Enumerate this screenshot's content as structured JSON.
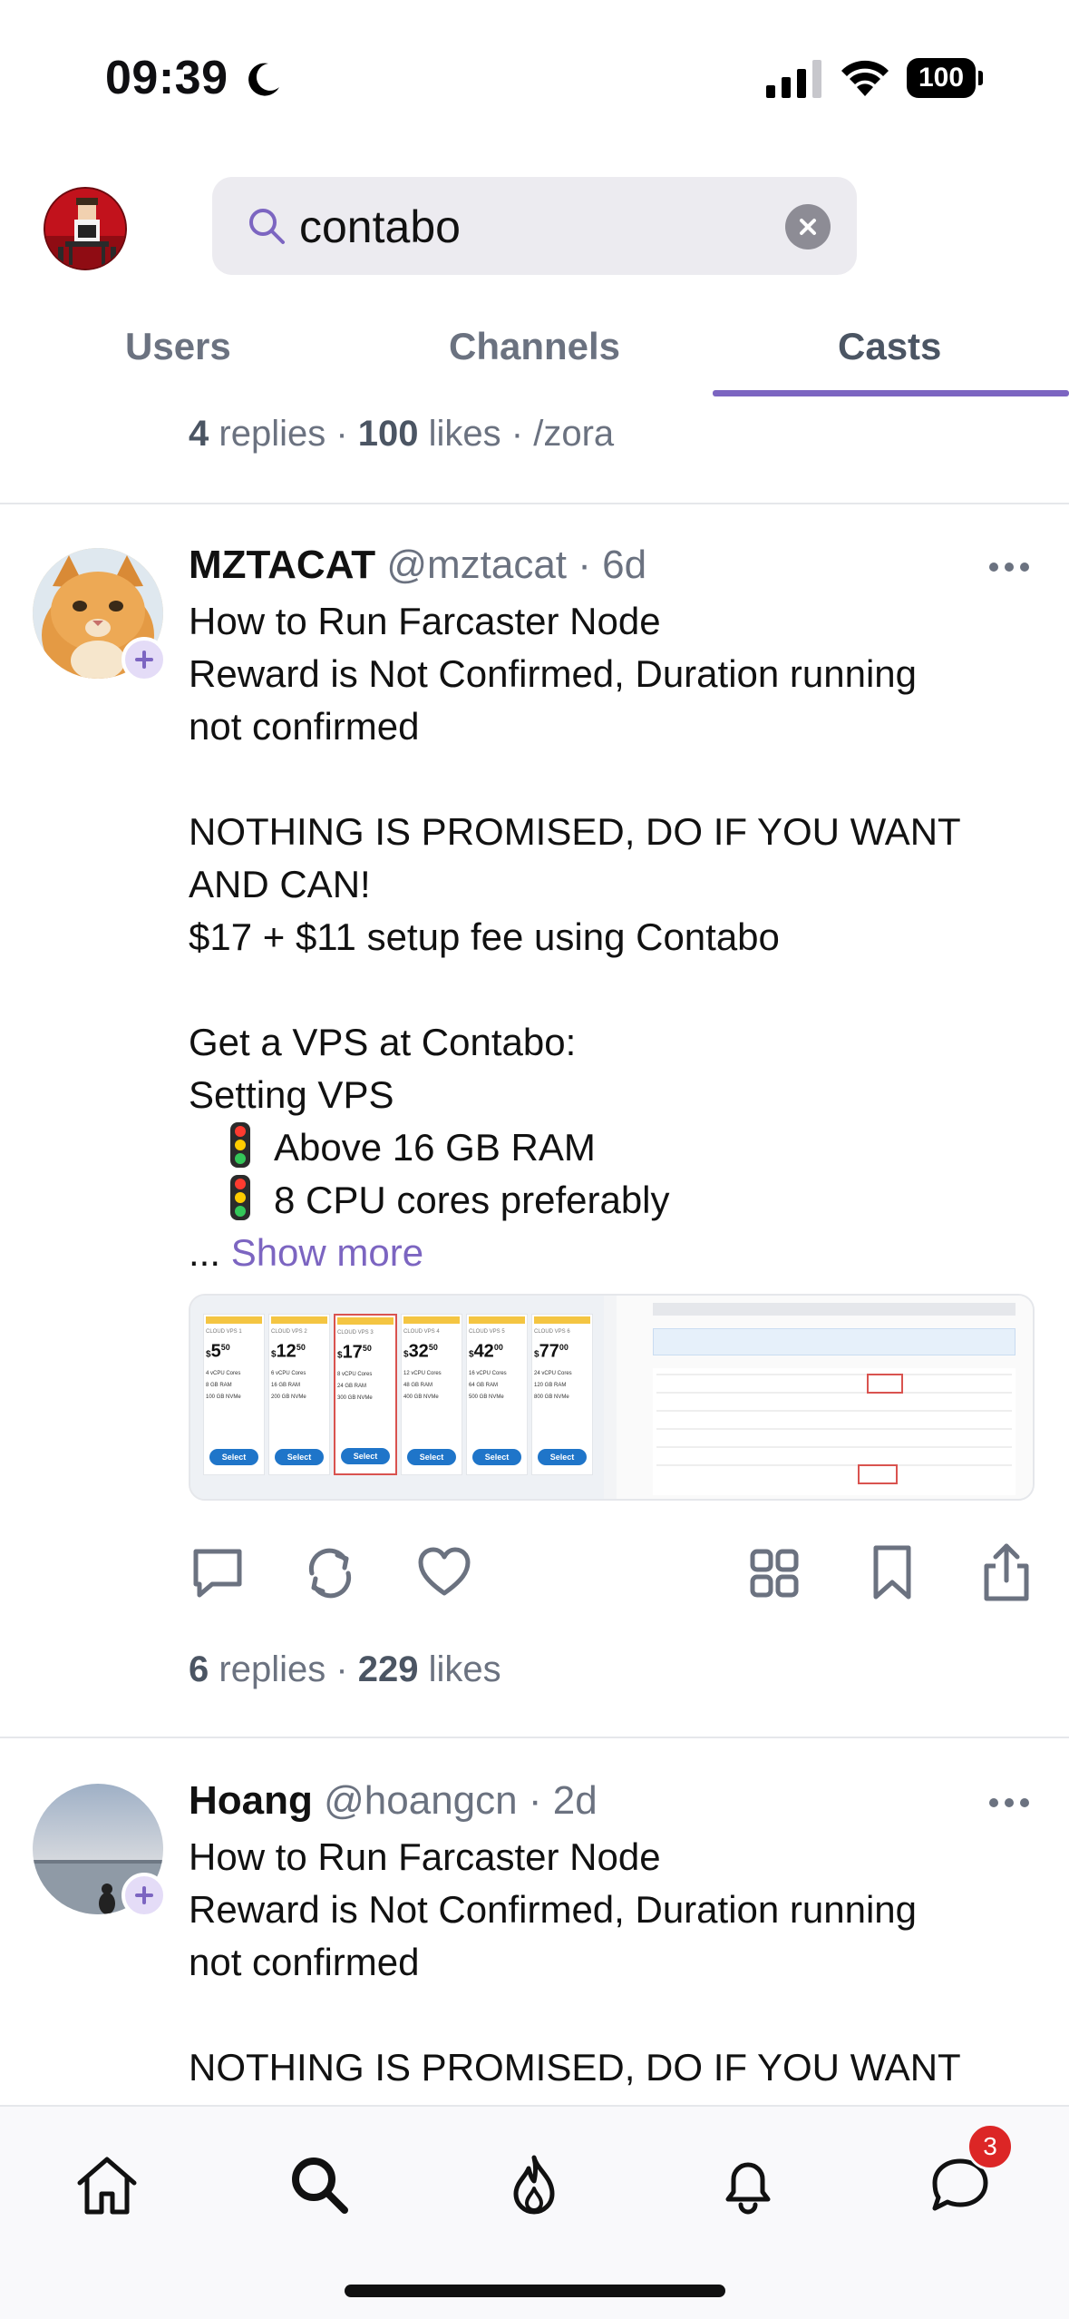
{
  "status_bar": {
    "time": "09:39",
    "battery": "100"
  },
  "search": {
    "query": "contabo"
  },
  "tabs": [
    {
      "label": "Users"
    },
    {
      "label": "Channels"
    },
    {
      "label": "Casts",
      "active": true
    }
  ],
  "prev_cast": {
    "replies_count": "4",
    "replies_label": "replies",
    "likes_count": "100",
    "likes_label": "likes",
    "channel": "/zora"
  },
  "casts": [
    {
      "name": "MZTACAT",
      "handle": "@mztacat",
      "age": "6d",
      "lines": [
        "How to Run Farcaster Node",
        "Reward is Not Confirmed, Duration running",
        "not confirmed",
        "NOTHING IS PROMISED, DO IF YOU WANT",
        "AND CAN!",
        "$17 + $11 setup fee using Contabo",
        "Get a VPS at Contabo:",
        "Setting VPS",
        "Above 16 GB RAM",
        "8 CPU cores preferably"
      ],
      "ellipsis": "...",
      "show_more": "Show more",
      "embed": {
        "plans": [
          {
            "name": "CLOUD VPS 1",
            "price": "5",
            "cents": "50",
            "cpu": "4 vCPU Cores",
            "ram": "8 GB RAM",
            "disk": "100 GB NVMe"
          },
          {
            "name": "CLOUD VPS 2",
            "price": "12",
            "cents": "50",
            "cpu": "6 vCPU Cores",
            "ram": "16 GB RAM",
            "disk": "200 GB NVMe"
          },
          {
            "name": "CLOUD VPS 3",
            "price": "17",
            "cents": "50",
            "cpu": "8 vCPU Cores",
            "ram": "24 GB RAM",
            "disk": "300 GB NVMe"
          },
          {
            "name": "CLOUD VPS 4",
            "price": "32",
            "cents": "50",
            "cpu": "12 vCPU Cores",
            "ram": "48 GB RAM",
            "disk": "400 GB NVMe"
          },
          {
            "name": "CLOUD VPS 5",
            "price": "42",
            "cents": "00",
            "cpu": "16 vCPU Cores",
            "ram": "64 GB RAM",
            "disk": "500 GB NVMe"
          },
          {
            "name": "CLOUD VPS 6",
            "price": "77",
            "cents": "00",
            "cpu": "24 vCPU Cores",
            "ram": "120 GB RAM",
            "disk": "800 GB NVMe"
          }
        ],
        "select_label": "Select"
      },
      "replies_count": "6",
      "replies_label": "replies",
      "likes_count": "229",
      "likes_label": "likes"
    },
    {
      "name": "Hoang",
      "handle": "@hoangcn",
      "age": "2d",
      "lines": [
        "How to Run Farcaster Node",
        "Reward is Not Confirmed, Duration running",
        "not confirmed",
        "NOTHING IS PROMISED, DO IF YOU WANT"
      ]
    }
  ],
  "nav": {
    "notifications_badge": "3"
  },
  "colors": {
    "accent": "#7c65c1",
    "muted": "#6b7280",
    "badge": "#dc2626"
  }
}
